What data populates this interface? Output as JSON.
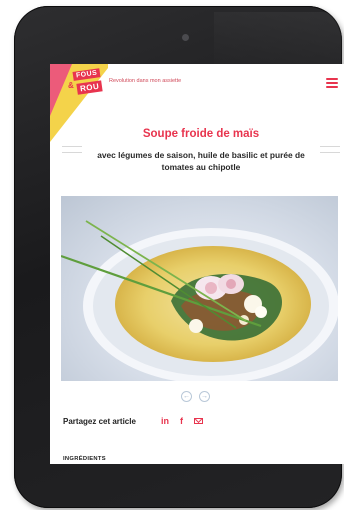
{
  "header": {
    "logo_top": "FOUS",
    "logo_amp": "&",
    "logo_bottom": "ROU",
    "tagline": "Revolution dans mon assiette"
  },
  "article": {
    "title": "Soupe froide de maïs",
    "subtitle": "avec légumes de saison, huile de basilic et purée de tomates au chipotle"
  },
  "pager": {
    "prev_icon": "←",
    "next_icon": "→"
  },
  "share": {
    "label": "Partagez cet article",
    "linkedin": "in",
    "facebook": "f"
  },
  "sections": {
    "ingredients": "INGRÉDIENTS"
  },
  "colors": {
    "accent": "#e8344e",
    "ribbon": "#f4d34a",
    "device": "#1e1e20"
  }
}
